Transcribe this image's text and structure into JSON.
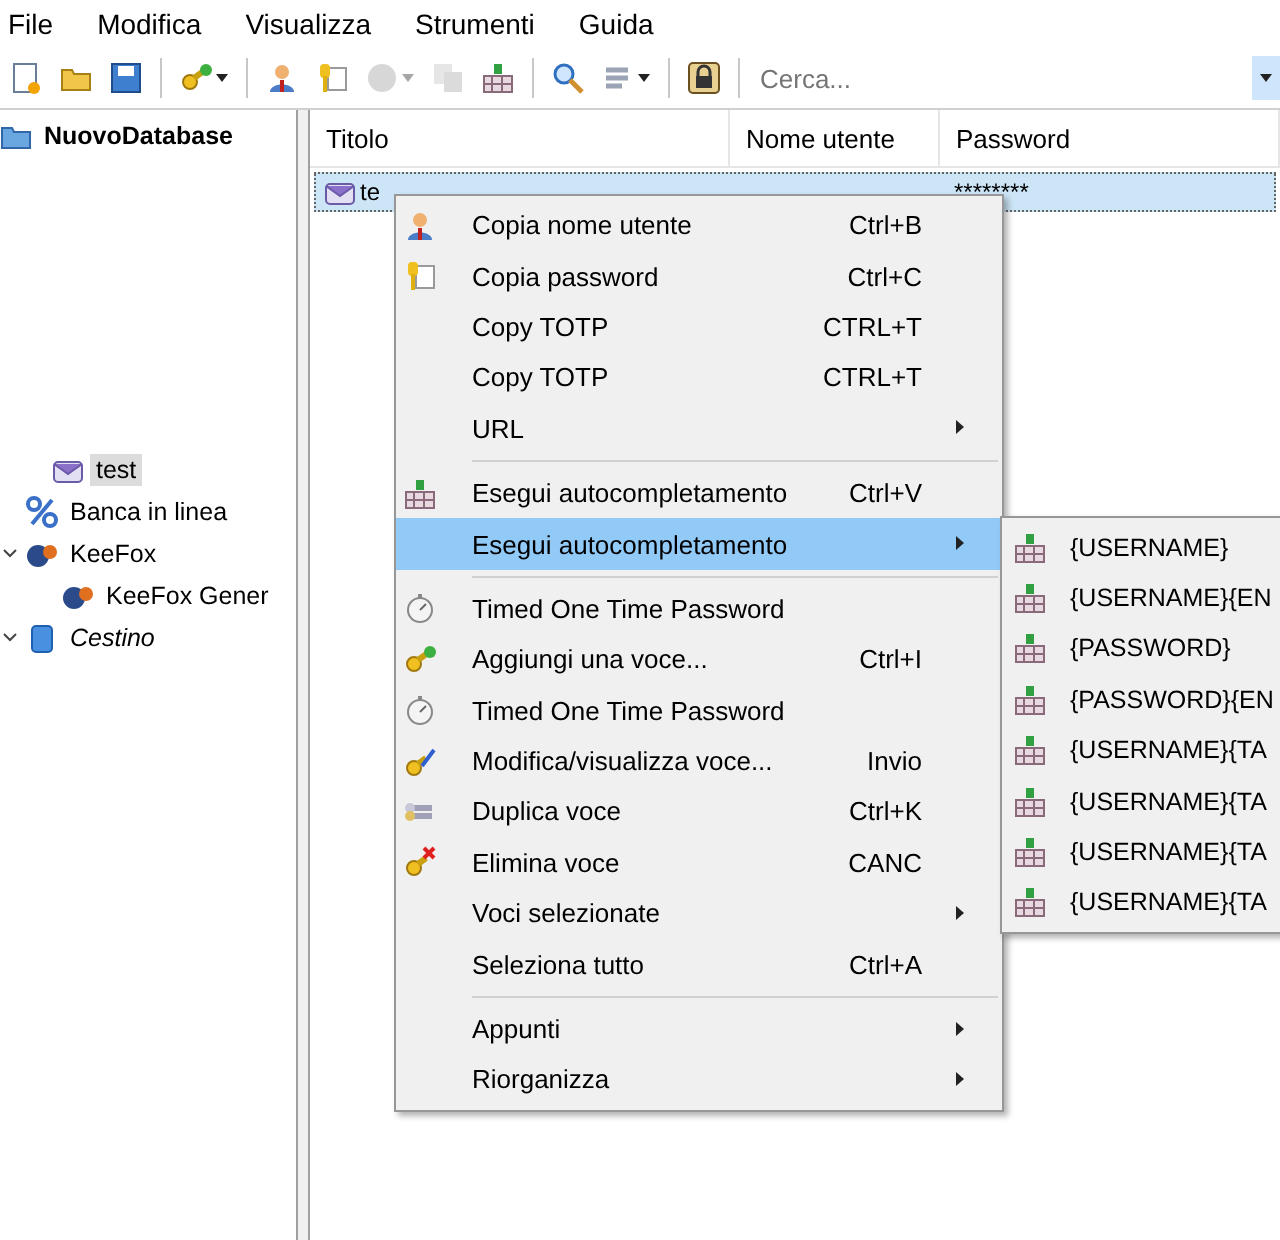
{
  "menubar": [
    "File",
    "Modifica",
    "Visualizza",
    "Strumenti",
    "Guida"
  ],
  "toolbar": {
    "buttons": [
      {
        "kind": "new",
        "disabled": false
      },
      {
        "kind": "open",
        "disabled": false
      },
      {
        "kind": "save",
        "disabled": false
      },
      {
        "kind": "sep"
      },
      {
        "kind": "addkey",
        "disabled": false,
        "dropdown": true
      },
      {
        "kind": "sep"
      },
      {
        "kind": "user",
        "disabled": false
      },
      {
        "kind": "password",
        "disabled": false
      },
      {
        "kind": "globe",
        "disabled": true,
        "dropdown": true
      },
      {
        "kind": "copy",
        "disabled": true
      },
      {
        "kind": "autotype",
        "disabled": false
      },
      {
        "kind": "sep"
      },
      {
        "kind": "search",
        "disabled": false
      },
      {
        "kind": "tools",
        "disabled": false,
        "dropdown": true
      },
      {
        "kind": "sep"
      },
      {
        "kind": "lock",
        "disabled": false
      },
      {
        "kind": "sep"
      }
    ],
    "search": {
      "placeholder": "Cerca..."
    }
  },
  "tree": {
    "label": "NuovoDatabase",
    "kind": "database",
    "selected": false,
    "children": [
      {
        "label": "test",
        "kind": "entry",
        "selected": true
      },
      {
        "label": "Banca in linea",
        "kind": "percent",
        "selected": false
      },
      {
        "label": "KeeFox",
        "kind": "keefox",
        "selected": false,
        "expanded": true,
        "children": [
          {
            "label": "KeeFox Gener",
            "kind": "keefox",
            "selected": false
          }
        ]
      },
      {
        "label": "Cestino",
        "kind": "bin",
        "selected": false,
        "expanded": true
      }
    ]
  },
  "table": {
    "columns": [
      "Titolo",
      "Nome utente",
      "Password"
    ],
    "rows": [
      {
        "selected": true,
        "cells": [
          "te",
          "",
          "********"
        ]
      }
    ]
  },
  "context_menu": [
    {
      "kind": "user",
      "label": "Copia nome utente",
      "shortcut": "Ctrl+B",
      "selected": false
    },
    {
      "kind": "password",
      "label": "Copia password",
      "shortcut": "Ctrl+C",
      "selected": false
    },
    {
      "kind": "plain",
      "label": "Copy TOTP",
      "shortcut": "CTRL+T",
      "selected": false
    },
    {
      "kind": "plain",
      "label": "Copy TOTP",
      "shortcut": "CTRL+T",
      "selected": false
    },
    {
      "kind": "plain",
      "label": "URL",
      "submenu": true,
      "selected": false
    },
    {
      "kind": "sep"
    },
    {
      "kind": "autotype",
      "label": "Esegui autocompletamento",
      "shortcut": "Ctrl+V",
      "selected": false
    },
    {
      "kind": "plain",
      "label": "Esegui autocompletamento",
      "submenu": true,
      "selected": true
    },
    {
      "kind": "sep"
    },
    {
      "kind": "timer",
      "label": "Timed One Time Password",
      "selected": false
    },
    {
      "kind": "addkey",
      "label": "Aggiungi una voce...",
      "shortcut": "Ctrl+I",
      "selected": false
    },
    {
      "kind": "timer",
      "label": "Timed One Time Password",
      "selected": false
    },
    {
      "kind": "editkey",
      "label": "Modifica/visualizza voce...",
      "shortcut": "Invio",
      "selected": false
    },
    {
      "kind": "dupkey",
      "label": "Duplica voce",
      "shortcut": "Ctrl+K",
      "selected": false
    },
    {
      "kind": "delkey",
      "label": "Elimina voce",
      "shortcut": "CANC",
      "selected": false
    },
    {
      "kind": "plain",
      "label": "Voci selezionate",
      "submenu": true,
      "selected": false
    },
    {
      "kind": "plain",
      "label": "Seleziona tutto",
      "shortcut": "Ctrl+A",
      "selected": false
    },
    {
      "kind": "sep"
    },
    {
      "kind": "plain",
      "label": "Appunti",
      "submenu": true,
      "selected": false
    },
    {
      "kind": "plain",
      "label": "Riorganizza",
      "submenu": true,
      "selected": false
    }
  ],
  "submenu": [
    "{USERNAME}",
    "{USERNAME}{EN",
    "{PASSWORD}",
    "{PASSWORD}{EN",
    "{USERNAME}{TA",
    "{USERNAME}{TA",
    "{USERNAME}{TA",
    "{USERNAME}{TA"
  ]
}
